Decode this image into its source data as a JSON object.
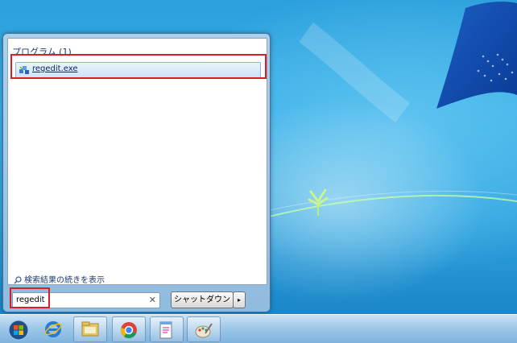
{
  "start_menu": {
    "group_header": "プログラム (1)",
    "results": [
      {
        "label": "regedit.exe",
        "icon": "regedit-icon"
      }
    ],
    "see_more_label": "検索結果の続きを表示",
    "search": {
      "value": "regedit",
      "clear_icon": "✕"
    },
    "shutdown_label": "シャットダウン",
    "shutdown_arrow": "▸"
  },
  "taskbar": {
    "items": [
      {
        "name": "start-orb"
      },
      {
        "name": "internet-explorer"
      },
      {
        "name": "windows-explorer"
      },
      {
        "name": "google-chrome"
      },
      {
        "name": "notepad"
      },
      {
        "name": "paint"
      }
    ]
  },
  "colors": {
    "highlight_box": "#d61f26",
    "wallpaper": "#2fa3de",
    "accent_link": "#0d2a60"
  }
}
